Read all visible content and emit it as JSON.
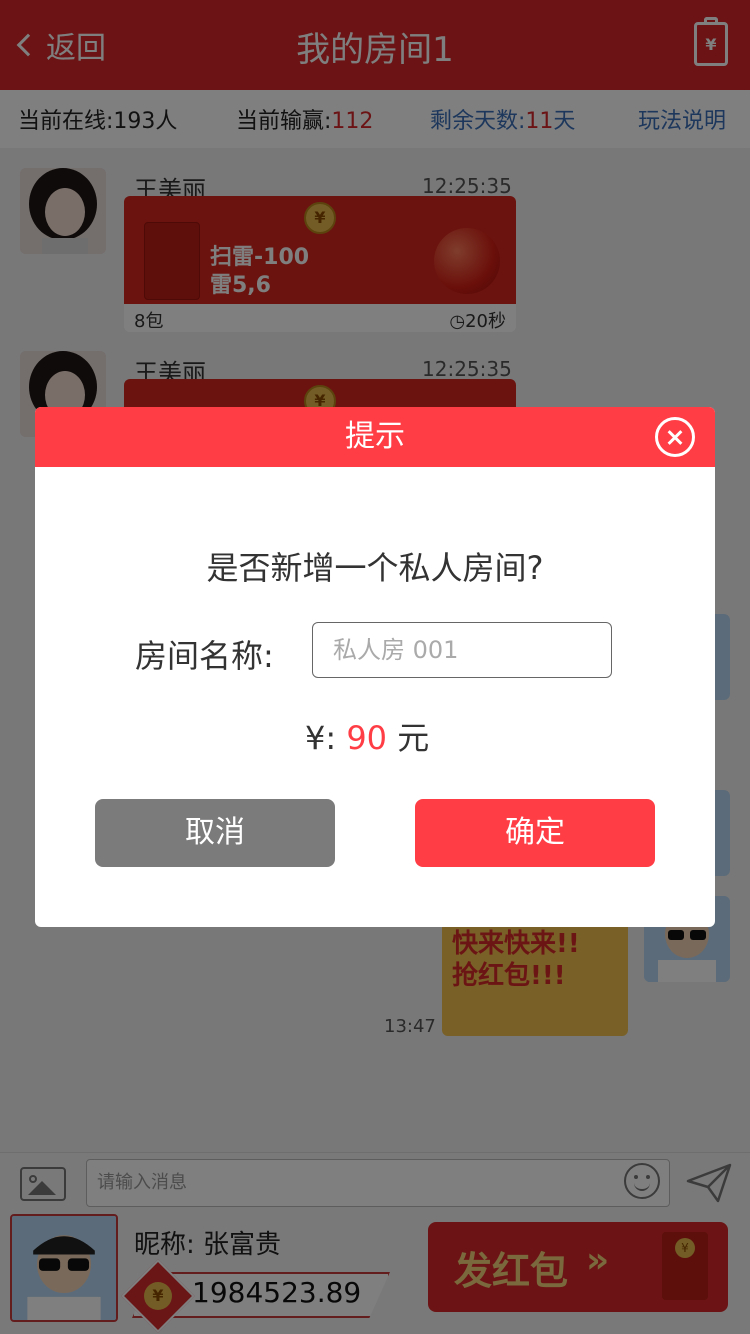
{
  "header": {
    "back_label": "返回",
    "title": "我的房间1",
    "clipboard_symbol": "¥"
  },
  "status": {
    "online_label": "当前在线:",
    "online_value": "193人",
    "winloss_label": "当前输赢:",
    "winloss_value": "112",
    "days_label": "剩余天数:",
    "days_value": "11",
    "days_unit": "天",
    "rules_label": "玩法说明"
  },
  "messages": [
    {
      "name": "王美丽",
      "time": "12:25:35",
      "packet_line1": "扫雷-100",
      "packet_line2": "雷5,6",
      "packet_count": "8包",
      "packet_timer": "20秒",
      "coin_symbol": "¥"
    },
    {
      "name": "王美丽",
      "time": "12:25:35",
      "coin_symbol": "¥"
    }
  ],
  "promo": {
    "text1": "快来快来!!",
    "text2": "抢红包!!!",
    "time": "13:47"
  },
  "input_bar": {
    "placeholder": "请输入消息"
  },
  "user": {
    "nickname_label": "昵称:",
    "nickname": "张富贵",
    "balance": "1984523.89",
    "coin_symbol": "¥",
    "send_packet_label": "发红包",
    "send_packet_arrow": "»"
  },
  "modal": {
    "title": "提示",
    "question": "是否新增一个私人房间?",
    "room_name_label": "房间名称:",
    "room_name_placeholder": "私人房 001",
    "price_prefix": "¥:",
    "price_value": "90",
    "price_unit": "元",
    "cancel_label": "取消",
    "confirm_label": "确定"
  },
  "colors": {
    "header_red": "#d8282a",
    "modal_red": "#ff3d45",
    "cancel_gray": "#7b7b7b",
    "link_blue": "#3a6fb9"
  }
}
